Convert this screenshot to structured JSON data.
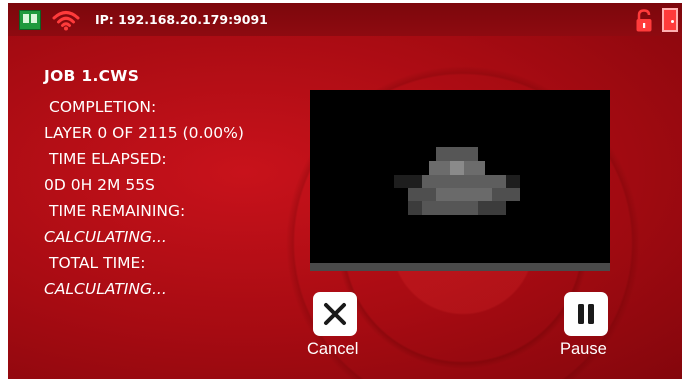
{
  "statusbar": {
    "ip": "IP: 192.168.20.179:9091",
    "icons": [
      "monitor-icon",
      "wifi-icon",
      "unlocked-padlock-icon",
      "door-icon"
    ],
    "accent_color": "#ff3b3b"
  },
  "job": {
    "name": "JOB 1.CWS",
    "completion_label": "COMPLETION:",
    "completion_value": "LAYER 0 OF 2115 (0.00%)",
    "elapsed_label": "TIME ELAPSED:",
    "elapsed_value": "0D 0H 2M 55S",
    "remaining_label": "TIME REMAINING:",
    "remaining_value": "CALCULATING...",
    "total_label": "TOTAL TIME:",
    "total_value": "CALCULATING..."
  },
  "preview": {
    "progress_fraction": 0.0
  },
  "actions": {
    "cancel_label": "Cancel",
    "cancel_icon": "close-icon",
    "pause_label": "Pause",
    "pause_icon": "pause-icon"
  },
  "colors": {
    "background": "#a60b12",
    "statusbar": "#7c070c",
    "text": "#ffffff"
  }
}
